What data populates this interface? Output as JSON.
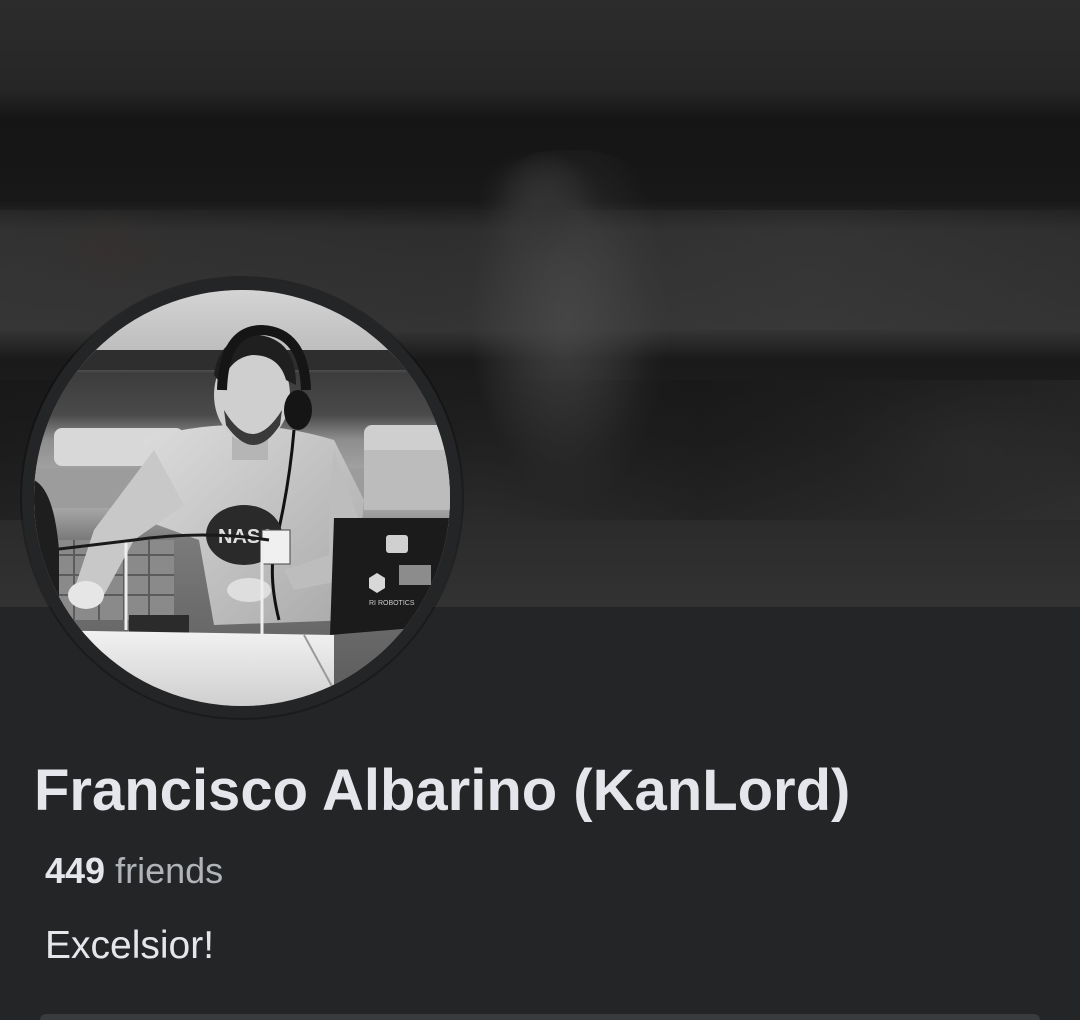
{
  "profile": {
    "name": "Francisco Albarino (KanLord)",
    "friends_count": "449",
    "friends_label": "friends",
    "bio": "Excelsior!"
  },
  "avatar_stickers": {
    "shirt_logo": "NASA",
    "laptop_text": "RI ROBOTICS"
  },
  "colors": {
    "background": "#242526",
    "primary_text": "#e4e6eb",
    "secondary_text": "#b0b3b8"
  }
}
